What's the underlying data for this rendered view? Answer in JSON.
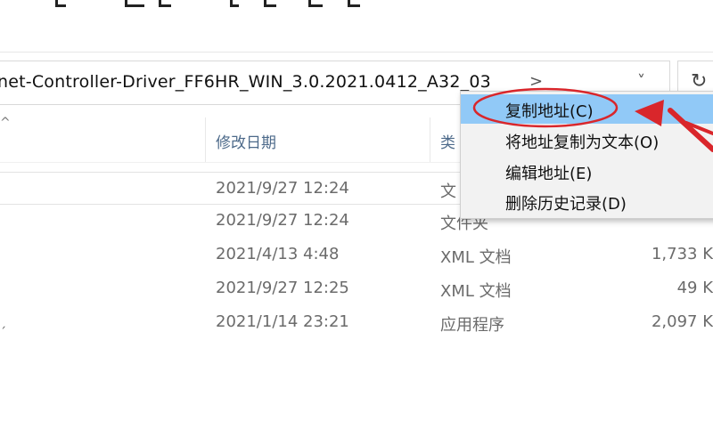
{
  "address_bar": {
    "path_text": "net-Controller-Driver_FF6HR_WIN_3.0.2021.0412_A32_03",
    "breadcrumb_chevron": ">",
    "dropdown_chevron": "˅",
    "refresh_icon": "refresh-icon"
  },
  "columns": {
    "modified_label": "修改日期",
    "type_label": "类"
  },
  "rows": [
    {
      "date": "2021/9/27 12:24",
      "type": "文",
      "size": ""
    },
    {
      "date": "2021/9/27 12:24",
      "type": "文件夹",
      "size": ""
    },
    {
      "date": "2021/4/13 4:48",
      "type": "XML 文档",
      "size": "1,733 K"
    },
    {
      "date": "2021/9/27 12:25",
      "type": "XML 文档",
      "size": "49 K"
    },
    {
      "date": "2021/1/14 23:21",
      "type": "应用程序",
      "size": "2,097 K"
    }
  ],
  "context_menu": {
    "items": [
      {
        "label": "复制地址(C)",
        "highlighted": true
      },
      {
        "label": "将地址复制为文本(O)",
        "highlighted": false
      },
      {
        "label": "编辑地址(E)",
        "highlighted": false
      },
      {
        "label": "删除历史记录(D)",
        "highlighted": false
      }
    ]
  },
  "colors": {
    "menu_highlight": "#91c9f7",
    "annotation_red": "#d9262b",
    "header_text": "#4d6a8a"
  }
}
